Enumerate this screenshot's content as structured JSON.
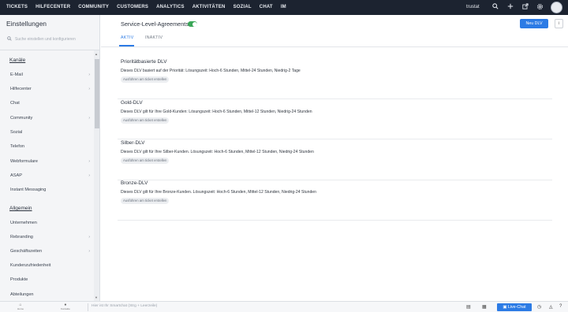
{
  "topnav": {
    "items": [
      "TICKETS",
      "HILFECENTER",
      "COMMUNITY",
      "CUSTOMERS",
      "ANALYTICS",
      "AKTIVITÄTEN",
      "SOZIAL",
      "CHAT",
      "IM"
    ],
    "brand": "trustat",
    "icons": [
      "search-icon",
      "plus-icon",
      "external-link-icon",
      "gear-icon",
      "avatar"
    ],
    "bg_color": "#1c2330"
  },
  "sidebar": {
    "title": "Einstellungen",
    "search_placeholder": "Suche einstellen und konfigurieren",
    "groups": [
      {
        "label": "Kanäle",
        "items": [
          {
            "label": "E-Mail",
            "chevron": true
          },
          {
            "label": "Hilfecenter",
            "chevron": true
          },
          {
            "label": "Chat",
            "chevron": false
          },
          {
            "label": "Community",
            "chevron": true
          },
          {
            "label": "Sozial",
            "chevron": false
          },
          {
            "label": "Telefon",
            "chevron": false
          },
          {
            "label": "Webformulare",
            "chevron": true
          },
          {
            "label": "ASAP",
            "chevron": true
          },
          {
            "label": "Instant Messaging",
            "chevron": false
          }
        ]
      },
      {
        "label": "Allgemein",
        "items": [
          {
            "label": "Unternehmen",
            "chevron": false
          },
          {
            "label": "Rebranding",
            "chevron": true
          },
          {
            "label": "Geschäftszeiten",
            "chevron": true
          },
          {
            "label": "Kundenzufriedenheit",
            "chevron": false
          },
          {
            "label": "Produkte",
            "chevron": false
          },
          {
            "label": "Abteilungen",
            "chevron": false
          }
        ]
      }
    ],
    "chevron_glyph": "›"
  },
  "header": {
    "title": "Service-Level-Agreements",
    "toggle_on": true,
    "tabs": [
      "AKTIV",
      "INAKTIV"
    ],
    "active_tab": "AKTIV",
    "new_button": "Neu DLV",
    "info_button": "i"
  },
  "slas": [
    {
      "name": "Prioritätbasierte DLV",
      "description": "Dieses DLV basiert auf der Priorität: Lösungszeit: Hoch-6 Stunden, Mittel-24 Stunden, Niedrig-2 Tage",
      "chip": "Ausführen am ticket erstellen"
    },
    {
      "name": "Gold-DLV",
      "description": "Dieses DLV gilt für Ihre Gold-Kunden: Lösungszeit: Hoch-6 Stunden, Mittel-12 Stunden, Niedrig-24 Stunden",
      "chip": "Ausführen am ticket erstellen"
    },
    {
      "name": "Silber-DLV",
      "description": "Dieses DLV gilt für Ihre Silber-Kunden. Lösungszeit: Hoch-6 Stunden, Mittel-12 Stunden, Niedrig-24 Stunden",
      "chip": "Ausführen am ticket erstellen"
    },
    {
      "name": "Bronze-DLV",
      "description": "Dieses DLV gilt für Ihre Bronze-Kunden. Lösungszeit: Hoch-6 Stunden, Mittel-12 Stunden, Niedrig-24 Stunden",
      "chip": "Ausführen am ticket erstellen"
    }
  ],
  "bottombar": {
    "left_items": [
      {
        "icon": "home-icon",
        "label": "Home"
      },
      {
        "icon": "contacts-icon",
        "label": "Kontakte"
      }
    ],
    "command_placeholder": "Hier ist Ihr Smartchat (Strg + Leerzeile)",
    "live_chat": "Live-Chat",
    "accent_color": "#2c7be5"
  }
}
